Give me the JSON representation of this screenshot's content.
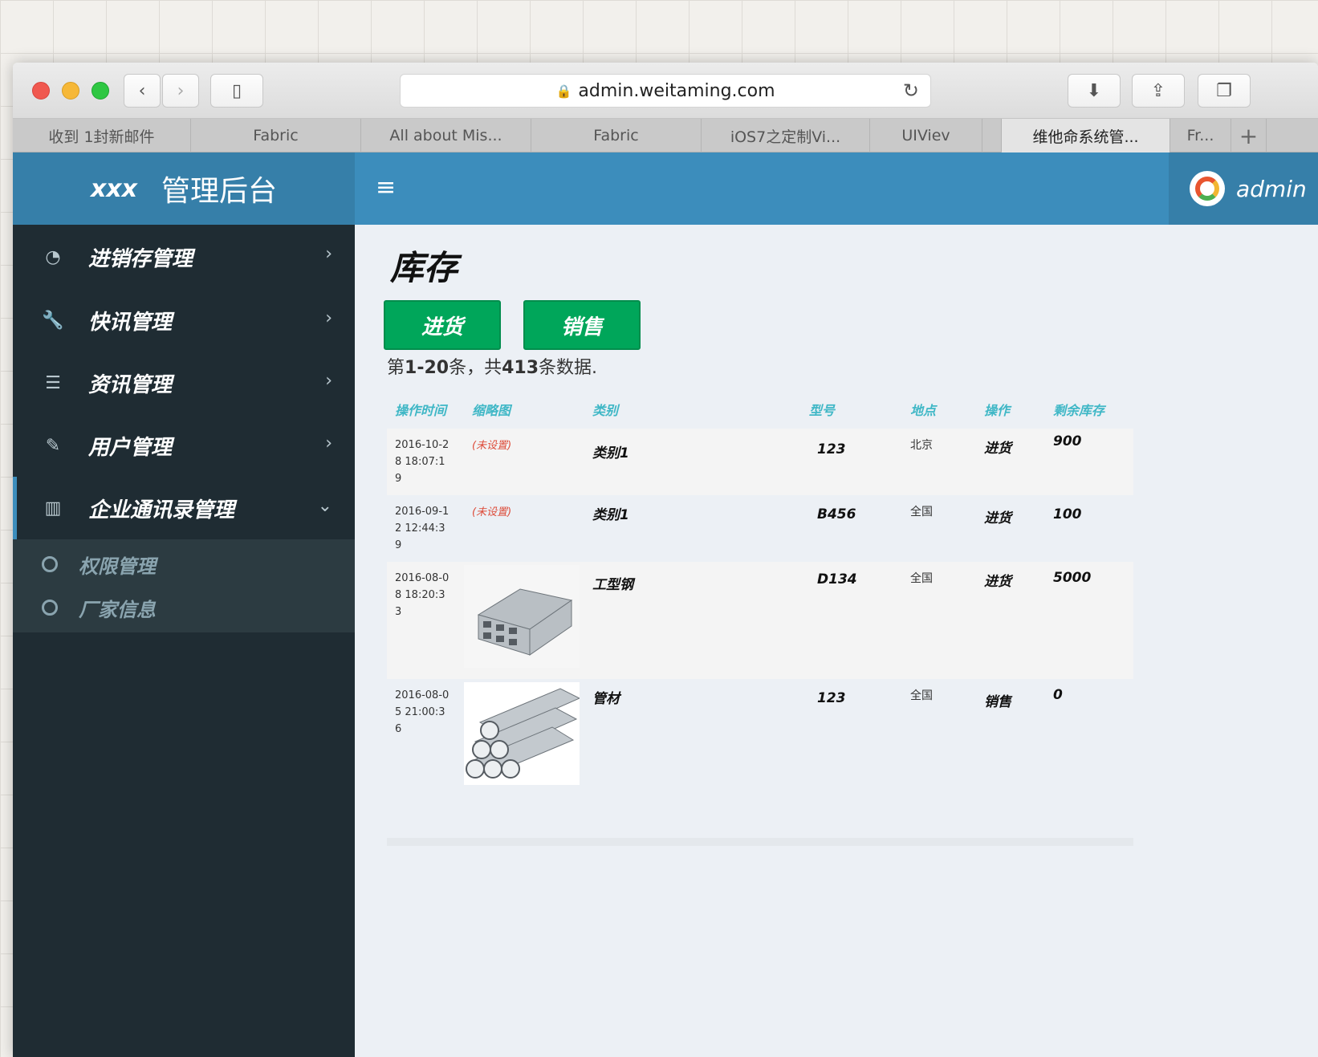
{
  "browser": {
    "url": "admin.weitaming.com",
    "tabs": [
      {
        "label": "收到 1封新邮件",
        "w": 222
      },
      {
        "label": "Fabric",
        "w": 212
      },
      {
        "label": "All about Mis...",
        "w": 212
      },
      {
        "label": "Fabric",
        "w": 212
      },
      {
        "label": "iOS7之定制Vi...",
        "w": 210
      },
      {
        "label": "UIViev",
        "w": 140
      },
      {
        "label": "",
        "w": 24
      },
      {
        "label": "维他命系统管...",
        "w": 210
      },
      {
        "label": "Fr...",
        "w": 76
      }
    ]
  },
  "header": {
    "logo_short": "xxx",
    "logo_long": "管理后台",
    "hamburger": "≡",
    "username": "admin"
  },
  "sidebar": {
    "items": [
      {
        "label": "进销存管理",
        "icon": "dashboard-icon",
        "glyph": "◔",
        "chev": "›"
      },
      {
        "label": "快讯管理",
        "icon": "wrench-icon",
        "glyph": "🔧",
        "chev": "›"
      },
      {
        "label": "资讯管理",
        "icon": "list-icon",
        "glyph": "☰",
        "chev": "›"
      },
      {
        "label": "用户管理",
        "icon": "edit-icon",
        "glyph": "✎",
        "chev": "›"
      },
      {
        "label": "企业通讯录管理",
        "icon": "bar-chart-icon",
        "glyph": "▥",
        "chev": "⌄"
      }
    ],
    "subitems": [
      {
        "label": "权限管理"
      },
      {
        "label": "厂家信息"
      }
    ]
  },
  "content": {
    "title": "库存",
    "btn_in": "进货",
    "btn_out": "销售",
    "summary_prefix": "第",
    "summary_range": "1-20",
    "summary_mid": "条，共",
    "summary_total": "413",
    "summary_suffix": "条数据."
  },
  "table": {
    "headers": [
      "操作时间",
      "缩略图",
      "类别",
      "型号",
      "地点",
      "操作",
      "剩余库存"
    ],
    "rows": [
      {
        "time": "2016-10-28 18:07:19",
        "thumb": "(未设置)",
        "category": "类别1",
        "model": "123",
        "location": "北京",
        "action": "进货",
        "stock": "900"
      },
      {
        "time": "2016-09-12 12:44:39",
        "thumb": "(未设置)",
        "category": "类别1",
        "model": "B456",
        "location": "全国",
        "action": "进货",
        "stock": "100"
      },
      {
        "time": "2016-08-08 18:20:33",
        "thumb": "",
        "category": "工型钢",
        "model": "D134",
        "location": "全国",
        "action": "进货",
        "stock": "5000"
      },
      {
        "time": "2016-08-05 21:00:36",
        "thumb": "",
        "category": "管材",
        "model": "123",
        "location": "全国",
        "action": "销售",
        "stock": "0"
      }
    ]
  }
}
